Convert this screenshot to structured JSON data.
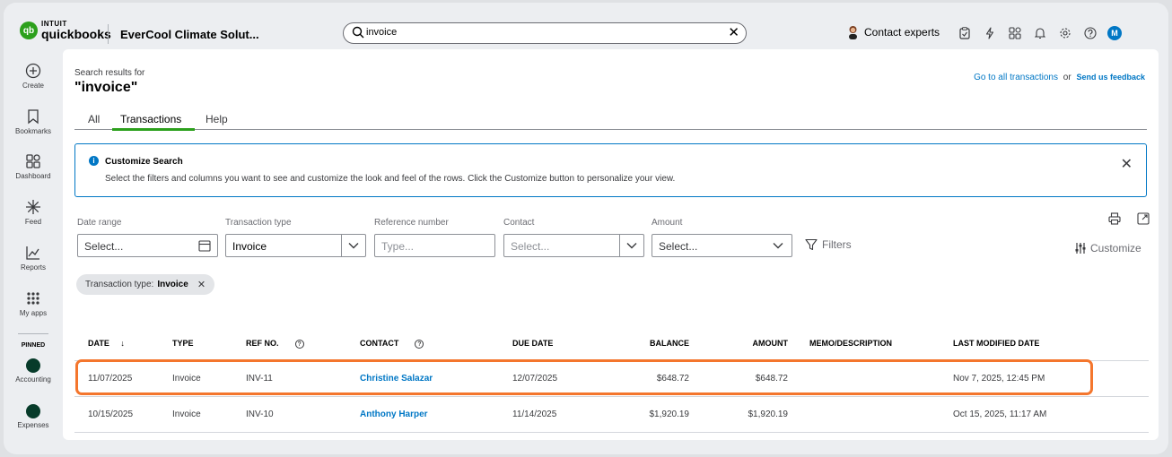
{
  "header": {
    "logo_intuit": "INTUIT",
    "logo_quickbooks": "quickbooks",
    "company": "EverCool Climate Solut...",
    "search_value": "invoice",
    "contact_experts": "Contact experts",
    "user_initial": "M"
  },
  "nav": {
    "items": [
      {
        "label": "Create",
        "icon": "plus-circle-icon"
      },
      {
        "label": "Bookmarks",
        "icon": "bookmark-icon"
      },
      {
        "label": "Dashboard",
        "icon": "dashboard-icon"
      },
      {
        "label": "Feed",
        "icon": "feed-icon"
      },
      {
        "label": "Reports",
        "icon": "reports-icon"
      },
      {
        "label": "My apps",
        "icon": "apps-grid-icon"
      }
    ],
    "pinned_label": "PINNED",
    "pinned": [
      {
        "label": "Accounting",
        "icon": "accounting-icon"
      },
      {
        "label": "Expenses",
        "icon": "expenses-icon"
      }
    ]
  },
  "main": {
    "results_for": "Search results for",
    "query": "\"invoice\"",
    "link_all_transactions": "Go to all transactions",
    "link_or": "or",
    "link_feedback": "Send us feedback",
    "tabs": [
      {
        "label": "All"
      },
      {
        "label": "Transactions"
      },
      {
        "label": "Help"
      }
    ],
    "banner": {
      "title": "Customize Search",
      "text": "Select the filters and columns you want to see and customize the look and feel of the rows. Click the Customize button to personalize your view."
    },
    "filters": {
      "date_range_label": "Date range",
      "date_range_placeholder": "Select...",
      "type_label": "Transaction type",
      "type_value": "Invoice",
      "ref_label": "Reference number",
      "ref_placeholder": "Type...",
      "contact_label": "Contact",
      "contact_placeholder": "Select...",
      "amount_label": "Amount",
      "amount_placeholder": "Select...",
      "filters_button": "Filters",
      "customize_button": "Customize"
    },
    "chip": {
      "label": "Transaction type:",
      "value": "Invoice"
    },
    "table": {
      "headers": {
        "date": "DATE",
        "type": "TYPE",
        "ref": "REF NO.",
        "contact": "CONTACT",
        "due": "DUE DATE",
        "balance": "BALANCE",
        "amount": "AMOUNT",
        "memo": "MEMO/DESCRIPTION",
        "modified": "LAST MODIFIED DATE"
      },
      "rows": [
        {
          "date": "11/07/2025",
          "type": "Invoice",
          "ref": "INV-11",
          "contact": "Christine Salazar",
          "due": "12/07/2025",
          "balance": "$648.72",
          "amount": "$648.72",
          "memo": "",
          "modified": "Nov 7, 2025, 12:45 PM"
        },
        {
          "date": "10/15/2025",
          "type": "Invoice",
          "ref": "INV-10",
          "contact": "Anthony Harper",
          "due": "11/14/2025",
          "balance": "$1,920.19",
          "amount": "$1,920.19",
          "memo": "",
          "modified": "Oct 15, 2025, 11:17 AM"
        }
      ]
    }
  }
}
